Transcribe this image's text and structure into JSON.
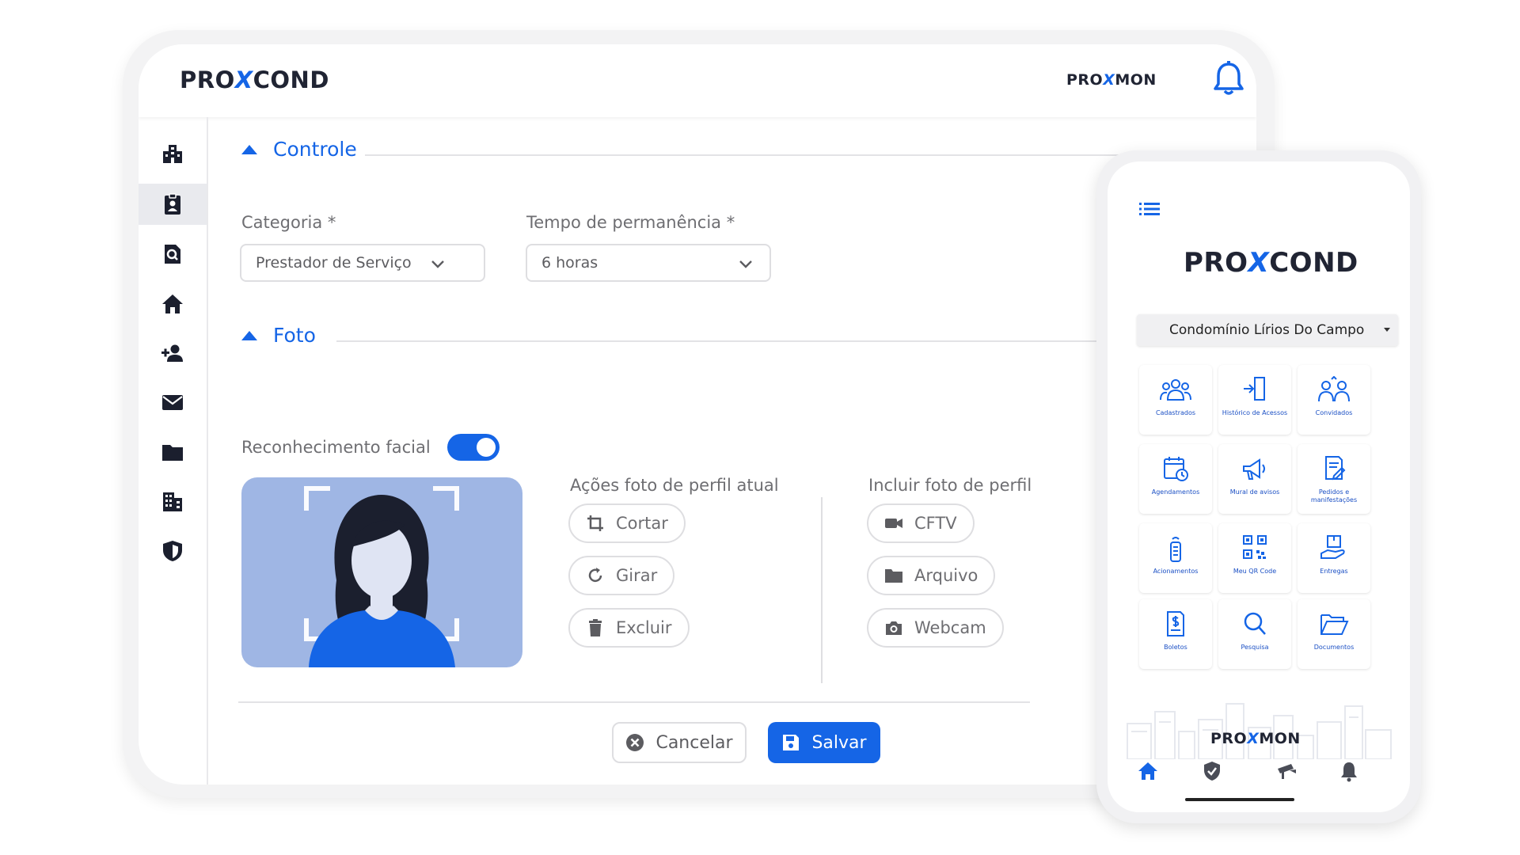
{
  "tablet": {
    "logo_left": "PRO",
    "logo_x": "X",
    "logo_right": "COND",
    "header_brand_left": "PRO",
    "header_brand_x": "X",
    "header_brand_right": "MON",
    "sidebar_icons": [
      "building-icon",
      "badge-icon",
      "search-document-icon",
      "home-icon",
      "add-user-icon",
      "mail-icon",
      "folder-icon",
      "office-building-icon",
      "shield-icon"
    ],
    "sidebar_active_index": 1,
    "sections": {
      "controle": "Controle",
      "foto": "Foto"
    },
    "fields": {
      "categoria_label": "Categoria *",
      "categoria_value": "Prestador de Serviço",
      "tempo_label": "Tempo de permanência *",
      "tempo_value": "6 horas"
    },
    "facial": {
      "label": "Reconhecimento facial",
      "enabled": true
    },
    "actions_current": {
      "label": "Ações foto de perfil atual",
      "buttons": [
        "Cortar",
        "Girar",
        "Excluir"
      ]
    },
    "actions_include": {
      "label": "Incluir foto de perfil",
      "buttons": [
        "CFTV",
        "Arquivo",
        "Webcam"
      ]
    },
    "footer": {
      "cancel": "Cancelar",
      "save": "Salvar"
    }
  },
  "phone": {
    "logo_left": "PRO",
    "logo_x": "X",
    "logo_right": "COND",
    "condo": "Condomínio Lírios Do Campo",
    "tiles": [
      {
        "label": "Cadastrados",
        "icon": "users-group-icon"
      },
      {
        "label": "Histórico de Acessos",
        "icon": "access-history-icon"
      },
      {
        "label": "Convidados",
        "icon": "guests-icon"
      },
      {
        "label": "Agendamentos",
        "icon": "calendar-clock-icon"
      },
      {
        "label": "Mural de avisos",
        "icon": "megaphone-icon"
      },
      {
        "label": "Pedidos e manifestações",
        "icon": "request-document-icon"
      },
      {
        "label": "Acionamentos",
        "icon": "remote-control-icon"
      },
      {
        "label": "Meu QR Code",
        "icon": "qr-code-icon"
      },
      {
        "label": "Entregas",
        "icon": "delivery-icon"
      },
      {
        "label": "Boletos",
        "icon": "bill-icon"
      },
      {
        "label": "Pesquisa",
        "icon": "search-icon"
      },
      {
        "label": "Documentos",
        "icon": "open-folder-icon"
      }
    ],
    "brand_left": "PRO",
    "brand_x": "X",
    "brand_right": "MON",
    "nav_icons": [
      "home-icon",
      "shield-icon",
      "camera-icon",
      "bell-icon"
    ]
  },
  "colors": {
    "accent": "#1565e6",
    "text_dark": "#202433",
    "muted": "#6e6e72"
  }
}
